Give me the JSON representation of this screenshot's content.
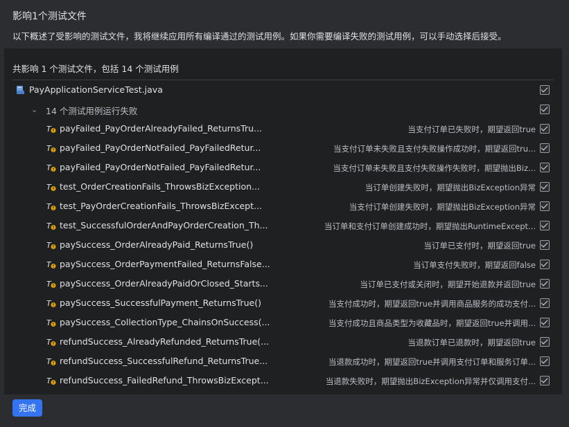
{
  "dialog": {
    "title": "影响1个测试文件",
    "description": "以下概述了受影响的测试文件，我将继续应用所有编译通过的测试用例。如果你需要编译失败的测试用例，可以手动选择后接受。"
  },
  "summary": "共影响 1 个测试文件，包括 14 个测试用例",
  "file": {
    "name": "PayApplicationServiceTest.java",
    "icon": "java-test-file-icon",
    "checked": true
  },
  "group": {
    "label": "14 个测试用例运行失败",
    "checked": true,
    "expanded": true
  },
  "tests": [
    {
      "name": "payFailed_PayOrderAlreadyFailed_ReturnsTru...",
      "description": "当支付订单已失败时，期望返回true",
      "checked": true
    },
    {
      "name": "payFailed_PayOrderNotFailed_PayFailedRetur...",
      "description": "当支付订单未失败且支付失败操作成功时，期望返回tru...",
      "checked": true
    },
    {
      "name": "payFailed_PayOrderNotFailed_PayFailedRetur...",
      "description": "当支付订单未失败且支付失败操作失败时，期望抛出Biz...",
      "checked": true
    },
    {
      "name": "test_OrderCreationFails_ThrowsBizException...",
      "description": "当订单创建失败时，期望抛出BizException异常",
      "checked": true
    },
    {
      "name": "test_PayOrderCreationFails_ThrowsBizExcept...",
      "description": "当支付订单创建失败时，期望抛出BizException异常",
      "checked": true
    },
    {
      "name": "test_SuccessfulOrderAndPayOrderCreation_Th...",
      "description": "当订单和支付订单创建成功时，期望抛出RuntimeExcept...",
      "checked": true
    },
    {
      "name": "paySuccess_OrderAlreadyPaid_ReturnsTrue()",
      "description": "当订单已支付时，期望返回true",
      "checked": true
    },
    {
      "name": "paySuccess_OrderPaymentFailed_ReturnsFalse...",
      "description": "当订单支付失败时，期望返回false",
      "checked": true
    },
    {
      "name": "paySuccess_OrderAlreadyPaidOrClosed_Starts...",
      "description": "当订单已支付或关闭时，期望开始退款并返回true",
      "checked": true
    },
    {
      "name": "paySuccess_SuccessfulPayment_ReturnsTrue()",
      "description": "当支付成功时，期望返回true并调用商品服务的成功支付...",
      "checked": true
    },
    {
      "name": "paySuccess_CollectionType_ChainsOnSuccess(...",
      "description": "当支付成功且商品类型为收藏品时，期望返回true并调用...",
      "checked": true
    },
    {
      "name": "refundSuccess_AlreadyRefunded_ReturnsTrue(...",
      "description": "当退款订单已退款时，期望返回true",
      "checked": true
    },
    {
      "name": "refundSuccess_SuccessfulRefund_ReturnsTrue...",
      "description": "当退款成功时，期望返回true并调用支付订单和服务订单...",
      "checked": true
    },
    {
      "name": "refundSuccess_FailedRefund_ThrowsBizExcept...",
      "description": "当退款失败时，期望抛出BizException异常并仅调用支付...",
      "checked": true
    }
  ],
  "buttons": {
    "done": "完成"
  },
  "colors": {
    "accent": "#3574f0",
    "warning": "#e5a50a",
    "background": "#2b2d30",
    "panel": "#1f2022"
  }
}
